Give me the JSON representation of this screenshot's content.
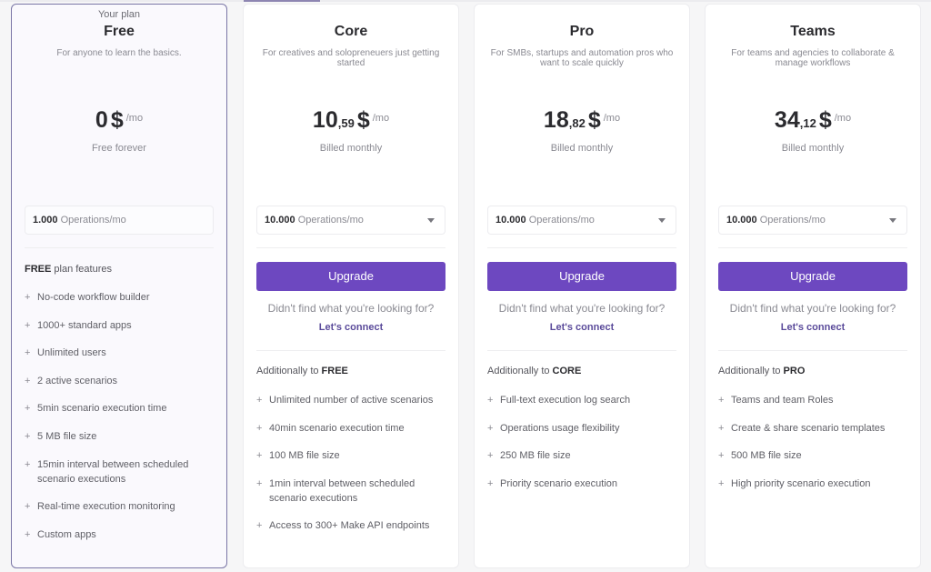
{
  "plans": [
    {
      "badge": "Your plan",
      "name": "Free",
      "description": "For anyone to learn the basics.",
      "price_int": "0",
      "price_cents": "",
      "currency": "$",
      "period": "/mo",
      "billing": "Free forever",
      "operations_value": "1.000",
      "operations_unit": "Operations/mo",
      "features_heading_bold": "FREE",
      "features_heading_rest": " plan features",
      "features": [
        "No-code workflow builder",
        "1000+ standard apps",
        "Unlimited users",
        "2 active scenarios",
        "5min scenario execution time",
        "5 MB file size",
        "15min interval between scheduled scenario executions",
        "Real-time execution monitoring",
        "Custom apps"
      ]
    },
    {
      "name": "Core",
      "description": "For creatives and solopreneuers just getting started",
      "price_int": "10",
      "price_cents": ",59",
      "currency": "$",
      "period": "/mo",
      "billing": "Billed monthly",
      "operations_value": "10.000",
      "operations_unit": "Operations/mo",
      "upgrade_label": "Upgrade",
      "not_found_text": "Didn't find what you're looking for?",
      "connect_label": "Let's connect",
      "features_heading_rest": "Additionally to ",
      "features_heading_bold": "FREE",
      "features": [
        "Unlimited number of active scenarios",
        "40min scenario execution time",
        "100 MB file size",
        "1min interval between scheduled scenario executions",
        "Access to 300+ Make API endpoints"
      ]
    },
    {
      "name": "Pro",
      "description": "For SMBs, startups and automation pros who want to scale quickly",
      "price_int": "18",
      "price_cents": ",82",
      "currency": "$",
      "period": "/mo",
      "billing": "Billed monthly",
      "operations_value": "10.000",
      "operations_unit": "Operations/mo",
      "upgrade_label": "Upgrade",
      "not_found_text": "Didn't find what you're looking for?",
      "connect_label": "Let's connect",
      "features_heading_rest": "Additionally to ",
      "features_heading_bold": "CORE",
      "features": [
        "Full-text execution log search",
        "Operations usage flexibility",
        "250 MB file size",
        "Priority scenario execution"
      ]
    },
    {
      "name": "Teams",
      "description": "For teams and agencies to collaborate & manage workflows",
      "price_int": "34",
      "price_cents": ",12",
      "currency": "$",
      "period": "/mo",
      "billing": "Billed monthly",
      "operations_value": "10.000",
      "operations_unit": "Operations/mo",
      "upgrade_label": "Upgrade",
      "not_found_text": "Didn't find what you're looking for?",
      "connect_label": "Let's connect",
      "features_heading_rest": "Additionally to ",
      "features_heading_bold": "PRO",
      "features": [
        "Teams and team Roles",
        "Create & share scenario templates",
        "500 MB file size",
        "High priority scenario execution"
      ]
    }
  ],
  "feature_bullet": "+",
  "colors": {
    "accent": "#6d48c0",
    "link": "#5a4a9a",
    "current_border": "#7a76a6"
  }
}
